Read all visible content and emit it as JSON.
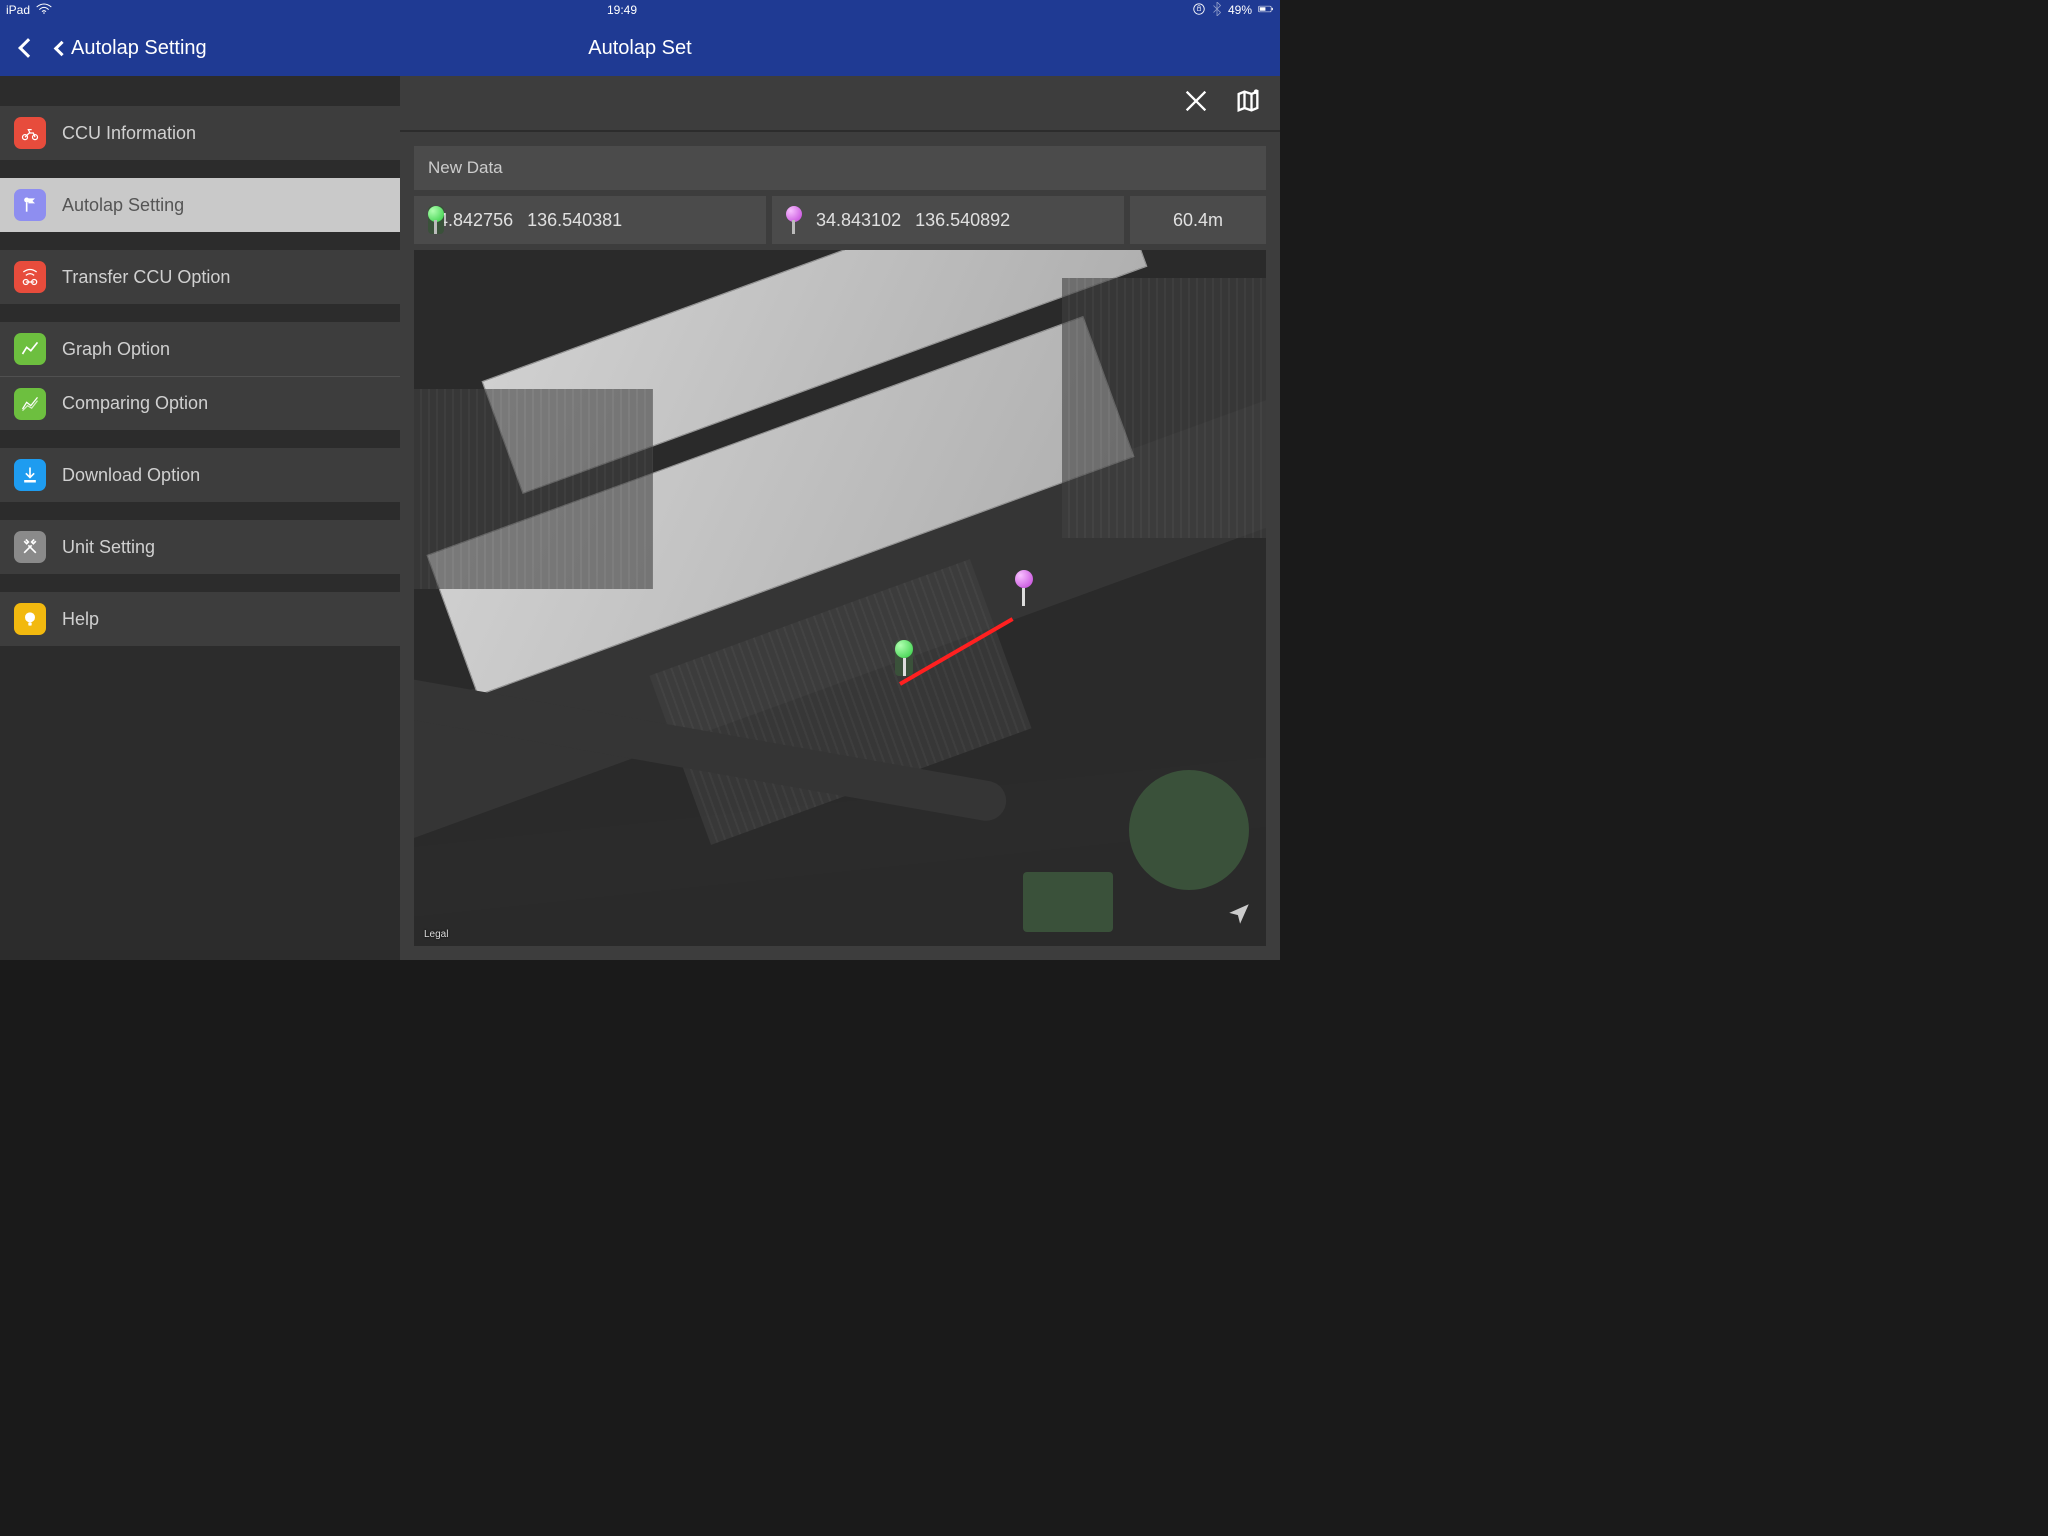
{
  "statusbar": {
    "device": "iPad",
    "time": "19:49",
    "battery_pct": "49%"
  },
  "navbar": {
    "back_sub_label": "Autolap Setting",
    "title": "Autolap Set"
  },
  "sidebar": {
    "items": [
      {
        "label": "CCU Information",
        "icon": "motorcycle-icon",
        "color": "ic-red"
      },
      {
        "label": "Autolap Setting",
        "icon": "flag-pin-icon",
        "color": "ic-purple",
        "selected": true
      },
      {
        "label": "Transfer CCU Option",
        "icon": "transfer-icon",
        "color": "ic-red"
      },
      {
        "label": "Graph Option",
        "icon": "graph-icon",
        "color": "ic-green"
      },
      {
        "label": "Comparing Option",
        "icon": "compare-icon",
        "color": "ic-green"
      },
      {
        "label": "Download Option",
        "icon": "download-icon",
        "color": "ic-blue"
      },
      {
        "label": "Unit Setting",
        "icon": "tools-icon",
        "color": "ic-gray"
      },
      {
        "label": "Help",
        "icon": "bulb-icon",
        "color": "ic-yellow"
      }
    ]
  },
  "main": {
    "new_data_label": "New Data",
    "point_a": {
      "lat": "34.842756",
      "lon": "136.540381"
    },
    "point_b": {
      "lat": "34.843102",
      "lon": "136.540892"
    },
    "distance": "60.4m",
    "map_legal": "Legal"
  }
}
